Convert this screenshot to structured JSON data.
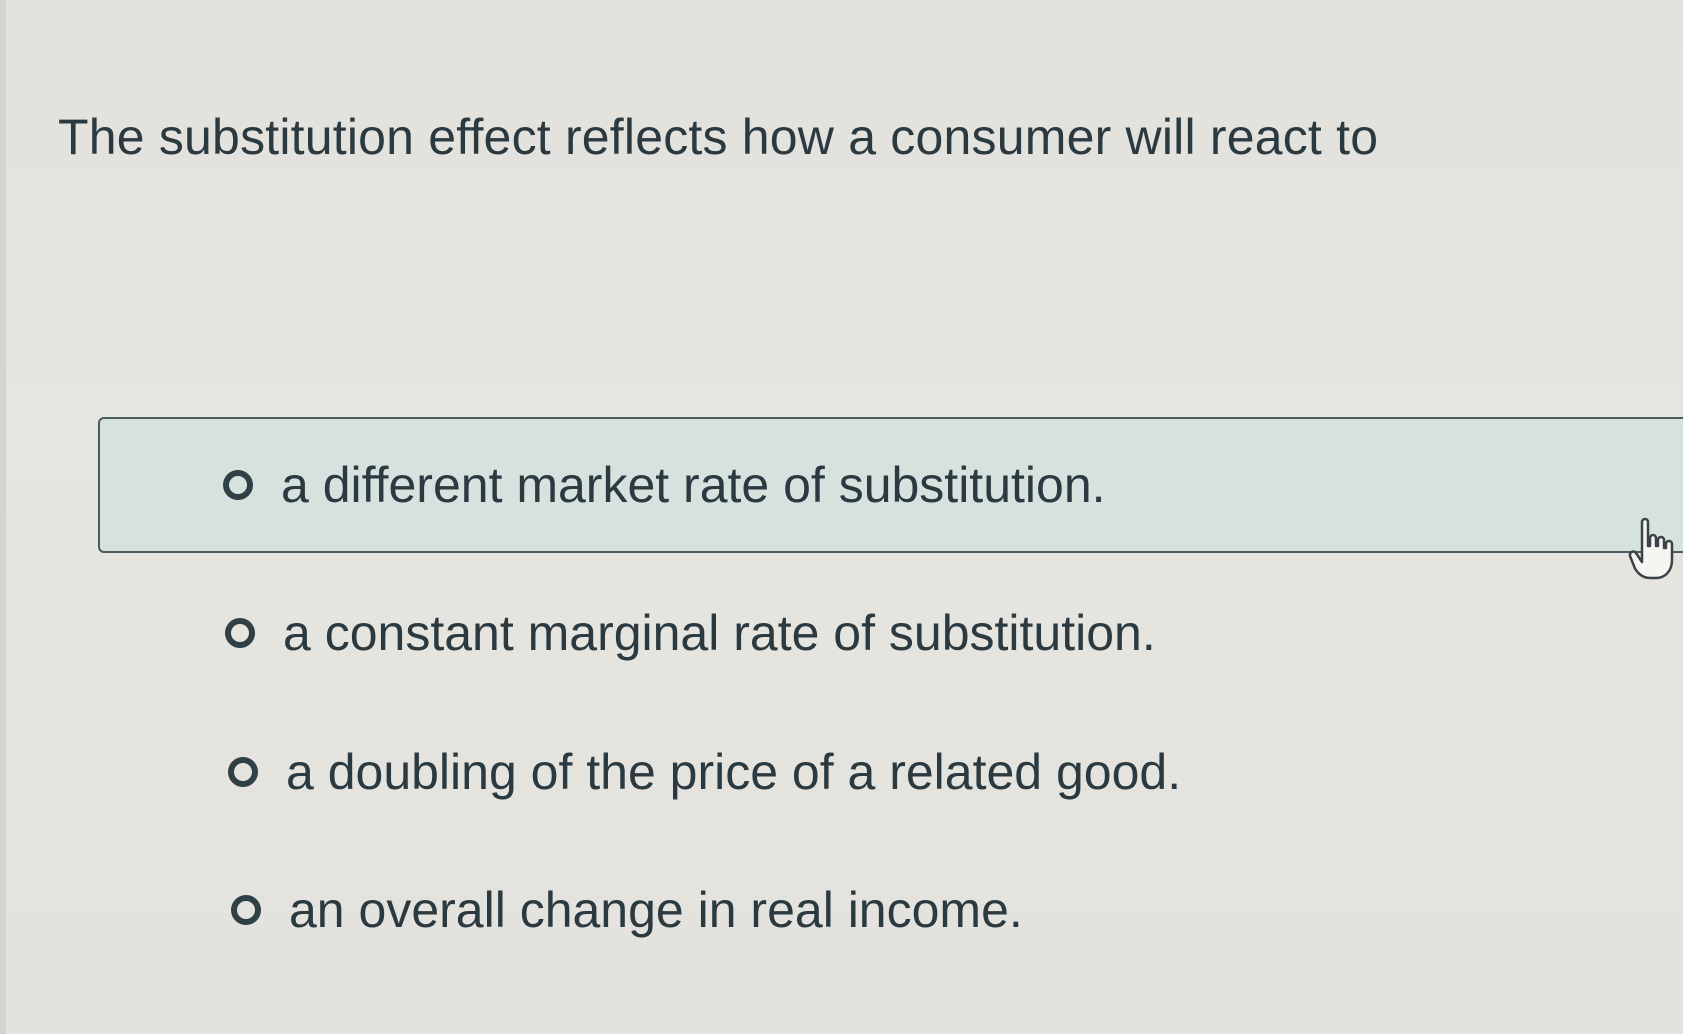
{
  "question": {
    "text": "The substitution effect reflects how a consumer will react to"
  },
  "options": [
    {
      "label": "a different market rate of substitution.",
      "highlighted": true
    },
    {
      "label": "a constant marginal rate of substitution.",
      "highlighted": false
    },
    {
      "label": "a doubling of the price of a related good.",
      "highlighted": false
    },
    {
      "label": "an overall change in real income.",
      "highlighted": false
    }
  ],
  "icons": {
    "radio": "radio-unselected-icon",
    "cursor": "hand-pointer-icon"
  },
  "colors": {
    "background": "#e6e4df",
    "highlight_background": "#d7e2de",
    "text": "#2a3a40",
    "radio_border": "#2f4046"
  }
}
